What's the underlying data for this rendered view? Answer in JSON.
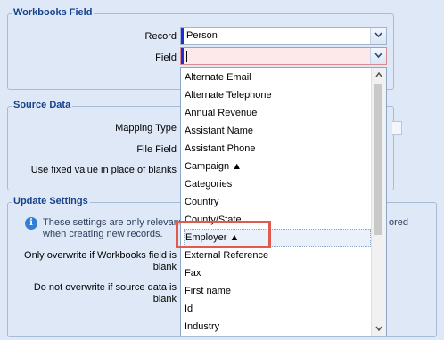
{
  "workbooks_field": {
    "legend": "Workbooks Field",
    "record_label": "Record",
    "record_value": "Person",
    "field_label": "Field",
    "field_value": ""
  },
  "source_data": {
    "legend": "Source Data",
    "mapping_type_label": "Mapping Type",
    "file_field_label": "File Field",
    "fixed_value_label": "Use fixed value in place of blanks"
  },
  "update_settings": {
    "legend": "Update Settings",
    "info_line1": "These settings are only relevant",
    "info_line1_tail": "ored",
    "info_line2": "when creating new records.",
    "only_overwrite_line1": "Only overwrite if Workbooks field is",
    "only_overwrite_line2": "blank",
    "do_not_overwrite_line1": "Do not overwrite if source data is",
    "do_not_overwrite_line2": "blank"
  },
  "dropdown": {
    "items": [
      "Alternate Email",
      "Alternate Telephone",
      "Annual Revenue",
      "Assistant Name",
      "Assistant Phone",
      "Campaign ▲",
      "Categories",
      "Country",
      "County/State",
      "Employer ▲",
      "External Reference",
      "Fax",
      "First name",
      "Id",
      "Industry"
    ],
    "selected_index": 9
  },
  "colors": {
    "background": "#dfe8f6",
    "legend_text": "#15428b",
    "highlight_box": "#e05a4d",
    "required_bar": "#1f2fcf"
  }
}
